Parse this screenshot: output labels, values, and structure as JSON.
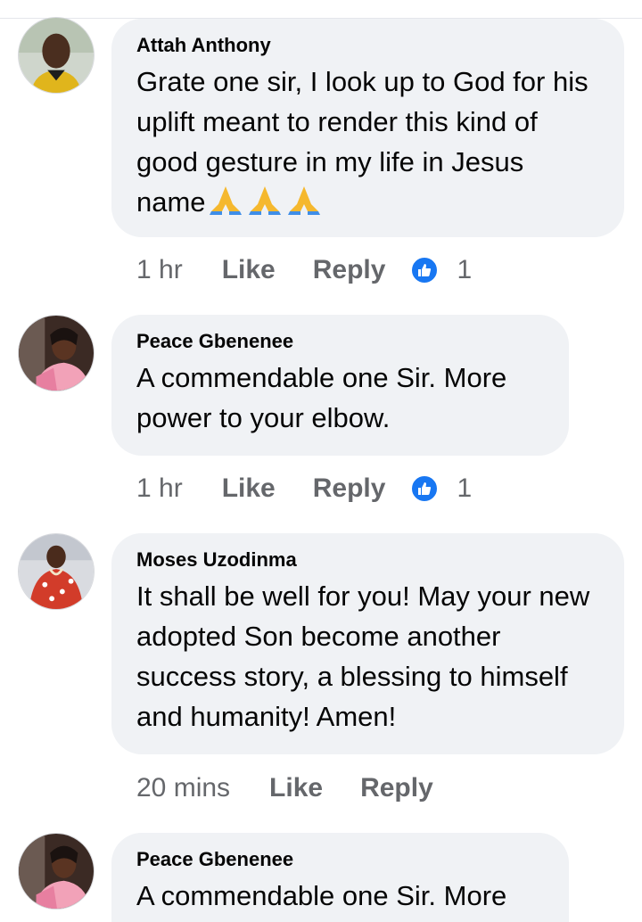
{
  "comments": [
    {
      "author": "Attah Anthony",
      "text": "Grate one sir, I look up to God for his uplift meant to render this kind of good gesture in my life in Jesus name",
      "emoji_count": 3,
      "time": "1 hr",
      "like_label": "Like",
      "reply_label": "Reply",
      "reaction_icon": "thumbs-up-icon",
      "reaction_count": "1"
    },
    {
      "author": "Peace Gbenenee",
      "text": "A commendable one Sir. More power to your elbow.",
      "time": "1 hr",
      "like_label": "Like",
      "reply_label": "Reply",
      "reaction_icon": "thumbs-up-icon",
      "reaction_count": "1"
    },
    {
      "author": "Moses Uzodinma",
      "text": "It shall be well for you! May your new adopted Son become another success story, a blessing to himself and humanity! Amen!",
      "time": "20 mins",
      "like_label": "Like",
      "reply_label": "Reply"
    },
    {
      "author": "Peace Gbenenee",
      "text": "A commendable one Sir. More"
    }
  ],
  "colors": {
    "bubble": "#f0f2f5",
    "meta_text": "#65676b",
    "like_blue": "#1877f2"
  }
}
